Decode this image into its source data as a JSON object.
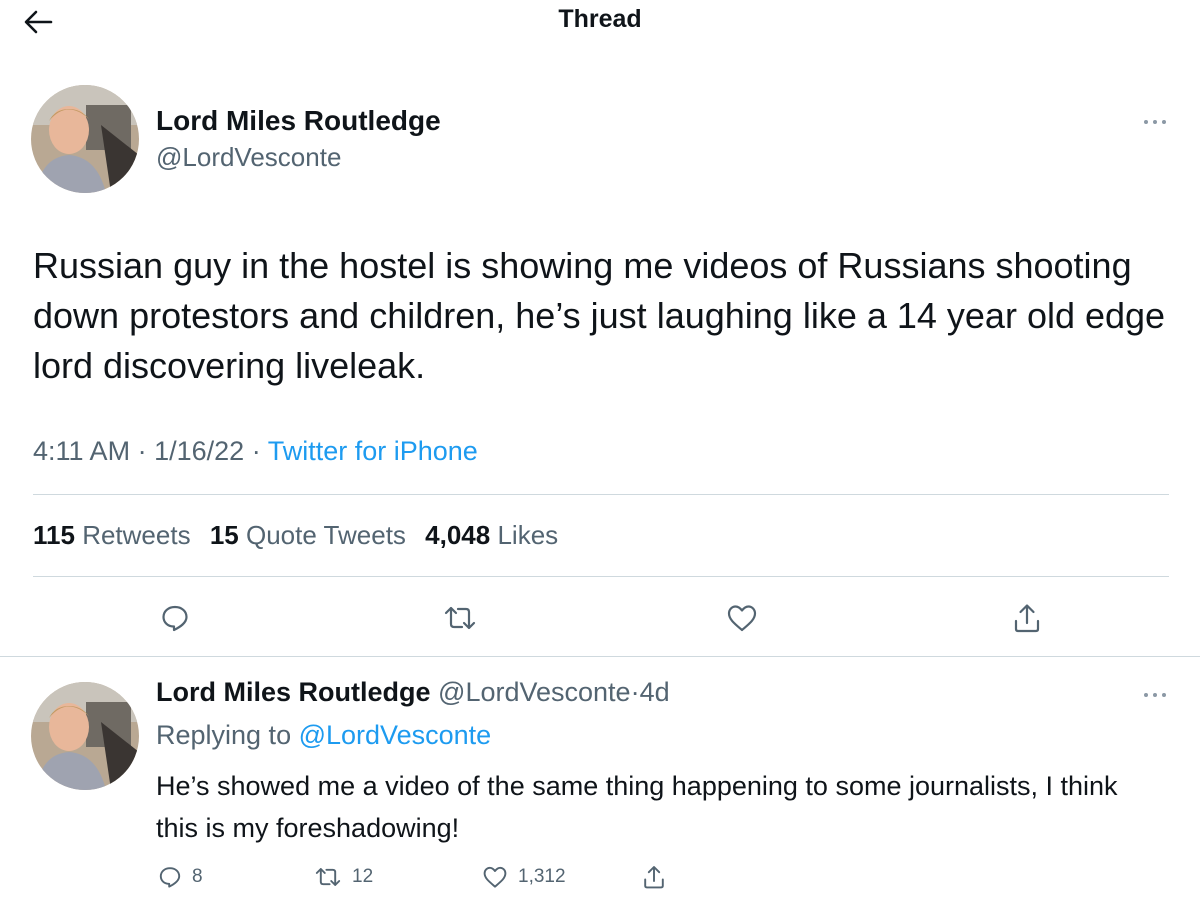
{
  "header": {
    "title": "Thread",
    "back_icon": "arrow-left-icon"
  },
  "main_tweet": {
    "author_name": "Lord Miles Routledge",
    "handle": "@LordVesconte",
    "text": "Russian guy in the hostel is showing me videos of Russians shooting down protestors and children, he’s just laughing like a 14 year old edge lord discovering liveleak.",
    "time": "4:11 AM",
    "date": "1/16/22",
    "separator": "·",
    "source": "Twitter for iPhone",
    "stats": {
      "retweets_count": "115",
      "retweets_label": "Retweets",
      "quotes_count": "15",
      "quotes_label": "Quote Tweets",
      "likes_count": "4,048",
      "likes_label": "Likes"
    }
  },
  "reply_tweet": {
    "author_name": "Lord Miles Routledge",
    "handle": "@LordVesconte",
    "separator": "·",
    "age": "4d",
    "replying_label": "Replying to",
    "replying_to": "@LordVesconte",
    "text": "He’s showed me a video of the same thing happening to some journalists, I think this is my foreshadowing!",
    "actions": {
      "replies": "8",
      "retweets": "12",
      "likes": "1,312"
    }
  },
  "colors": {
    "text": "#0f1419",
    "secondary": "#536471",
    "accent": "#1d9bf0",
    "divider": "#cfd9de"
  }
}
